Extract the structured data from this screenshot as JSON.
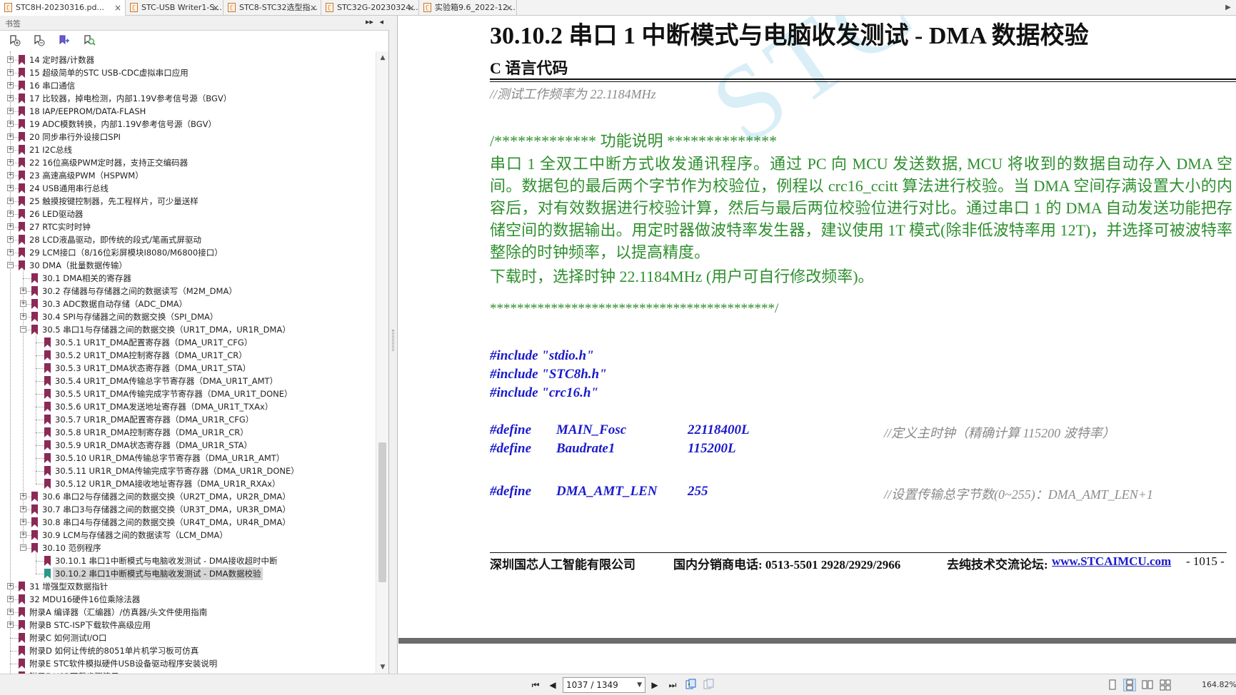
{
  "tabs": [
    {
      "label": "STC8H-20230316.pd...",
      "active": true
    },
    {
      "label": "STC-USB Writer1-S..."
    },
    {
      "label": "STC8-STC32选型指..."
    },
    {
      "label": "STC32G-20230324..."
    },
    {
      "label": "实验箱9.6_2022-12-..."
    }
  ],
  "panel": {
    "title": "书签",
    "expand_glyph": "▸▸",
    "collapse_glyph": "◂"
  },
  "bookmarks": [
    {
      "label": "14 定时器/计数器",
      "level": 0,
      "expander": "+"
    },
    {
      "label": "15 超级简单的STC USB-CDC虚拟串口应用",
      "level": 0,
      "expander": "+"
    },
    {
      "label": "16 串口通信",
      "level": 0,
      "expander": "+"
    },
    {
      "label": "17 比较器，掉电检测，内部1.19V参考信号源（BGV）",
      "level": 0,
      "expander": "+"
    },
    {
      "label": "18 IAP/EEPROM/DATA-FLASH",
      "level": 0,
      "expander": "+"
    },
    {
      "label": "19 ADC模数转换，内部1.19V参考信号源（BGV）",
      "level": 0,
      "expander": "+"
    },
    {
      "label": "20 同步串行外设接口SPI",
      "level": 0,
      "expander": "+"
    },
    {
      "label": "21 I2C总线",
      "level": 0,
      "expander": "+"
    },
    {
      "label": "22 16位高级PWM定时器，支持正交编码器",
      "level": 0,
      "expander": "+"
    },
    {
      "label": "23 高速高级PWM（HSPWM）",
      "level": 0,
      "expander": "+"
    },
    {
      "label": "24 USB通用串行总线",
      "level": 0,
      "expander": "+"
    },
    {
      "label": "25 触摸按键控制器，先工程样片，可少量送样",
      "level": 0,
      "expander": "+"
    },
    {
      "label": "26 LED驱动器",
      "level": 0,
      "expander": "+"
    },
    {
      "label": "27 RTC实时时钟",
      "level": 0,
      "expander": "+"
    },
    {
      "label": "28 LCD液晶驱动，即传统的段式/笔画式屏驱动",
      "level": 0,
      "expander": "+"
    },
    {
      "label": "29 LCM接口（8/16位彩屏模块I8080/M6800接口）",
      "level": 0,
      "expander": "+"
    },
    {
      "label": "30 DMA（批量数据传输）",
      "level": 0,
      "expander": "−"
    },
    {
      "label": "30.1 DMA相关的寄存器",
      "level": 1,
      "expander": ""
    },
    {
      "label": "30.2 存储器与存储器之间的数据读写（M2M_DMA）",
      "level": 1,
      "expander": "+"
    },
    {
      "label": "30.3 ADC数据自动存储（ADC_DMA）",
      "level": 1,
      "expander": "+"
    },
    {
      "label": "30.4 SPI与存储器之间的数据交换（SPI_DMA）",
      "level": 1,
      "expander": "+"
    },
    {
      "label": "30.5 串口1与存储器之间的数据交换（UR1T_DMA，UR1R_DMA）",
      "level": 1,
      "expander": "−"
    },
    {
      "label": "30.5.1 UR1T_DMA配置寄存器（DMA_UR1T_CFG）",
      "level": 2,
      "expander": ""
    },
    {
      "label": "30.5.2 UR1T_DMA控制寄存器（DMA_UR1T_CR）",
      "level": 2,
      "expander": ""
    },
    {
      "label": "30.5.3 UR1T_DMA状态寄存器（DMA_UR1T_STA）",
      "level": 2,
      "expander": ""
    },
    {
      "label": "30.5.4 UR1T_DMA传输总字节寄存器（DMA_UR1T_AMT）",
      "level": 2,
      "expander": ""
    },
    {
      "label": "30.5.5 UR1T_DMA传输完成字节寄存器（DMA_UR1T_DONE）",
      "level": 2,
      "expander": ""
    },
    {
      "label": "30.5.6 UR1T_DMA发送地址寄存器（DMA_UR1T_TXAx）",
      "level": 2,
      "expander": ""
    },
    {
      "label": "30.5.7 UR1R_DMA配置寄存器（DMA_UR1R_CFG）",
      "level": 2,
      "expander": ""
    },
    {
      "label": "30.5.8 UR1R_DMA控制寄存器（DMA_UR1R_CR）",
      "level": 2,
      "expander": ""
    },
    {
      "label": "30.5.9 UR1R_DMA状态寄存器（DMA_UR1R_STA）",
      "level": 2,
      "expander": ""
    },
    {
      "label": "30.5.10 UR1R_DMA传输总字节寄存器（DMA_UR1R_AMT）",
      "level": 2,
      "expander": ""
    },
    {
      "label": "30.5.11 UR1R_DMA传输完成字节寄存器（DMA_UR1R_DONE）",
      "level": 2,
      "expander": ""
    },
    {
      "label": "30.5.12 UR1R_DMA接收地址寄存器（DMA_UR1R_RXAx）",
      "level": 2,
      "expander": ""
    },
    {
      "label": "30.6 串口2与存储器之间的数据交换（UR2T_DMA，UR2R_DMA）",
      "level": 1,
      "expander": "+"
    },
    {
      "label": "30.7 串口3与存储器之间的数据交换（UR3T_DMA，UR3R_DMA）",
      "level": 1,
      "expander": "+"
    },
    {
      "label": "30.8 串口4与存储器之间的数据交换（UR4T_DMA，UR4R_DMA）",
      "level": 1,
      "expander": "+"
    },
    {
      "label": "30.9 LCM与存储器之间的数据读写（LCM_DMA）",
      "level": 1,
      "expander": "+"
    },
    {
      "label": "30.10 范例程序",
      "level": 1,
      "expander": "−"
    },
    {
      "label": "30.10.1 串口1中断模式与电脑收发测试 - DMA接收超时中断",
      "level": 2,
      "expander": ""
    },
    {
      "label": "30.10.2 串口1中断模式与电脑收发测试 - DMA数据校验",
      "level": 2,
      "expander": "",
      "selected": true
    },
    {
      "label": "31 增强型双数据指针",
      "level": 0,
      "expander": "+"
    },
    {
      "label": "32 MDU16硬件16位乘除法器",
      "level": 0,
      "expander": "+"
    },
    {
      "label": "附录A 编译器（汇编器）/仿真器/头文件使用指南",
      "level": 0,
      "expander": "+"
    },
    {
      "label": "附录B STC-ISP下载软件高级应用",
      "level": 0,
      "expander": "+"
    },
    {
      "label": "附录C 如何测试I/O口",
      "level": 0,
      "expander": ""
    },
    {
      "label": "附录D 如何让传统的8051单片机学习板可仿真",
      "level": 0,
      "expander": ""
    },
    {
      "label": "附录E STC软件模拟硬件USB设备驱动程序安装说明",
      "level": 0,
      "expander": ""
    },
    {
      "label": "附录F USB下载步骤演示",
      "level": 0,
      "expander": ""
    }
  ],
  "document": {
    "watermark": "STC",
    "section_title": "30.10.2   串口 1 中断模式与电脑收发测试  - DMA 数据校验",
    "subsection_title": "C 语言代码",
    "freq_comment": "//测试工作频率为 22.1184MHz",
    "func_header": "/*************    功能说明      **************",
    "description": "串口 1 全双工中断方式收发通讯程序。通过 PC 向 MCU 发送数据, MCU 将收到的数据自动存入 DMA 空间。数据包的最后两个字节作为校验位，例程以 crc16_ccitt 算法进行校验。当 DMA 空间存满设置大小的内容后，对有效数据进行校验计算，然后与最后两位校验位进行对比。通过串口 1 的 DMA 自动发送功能把存储空间的数据输出。用定时器做波特率发生器，建议使用 1T 模式(除非低波特率用 12T)，并选择可被波特率整除的时钟频率，以提高精度。",
    "download_note": "下载时，选择时钟  22.1184MHz (用户可自行修改频率)。",
    "stars_end": "******************************************/",
    "includes": [
      "#include \"stdio.h\"",
      "#include \"STC8h.h\"",
      "#include \"crc16.h\""
    ],
    "defines": [
      {
        "kw": "#define",
        "name": "MAIN_Fosc",
        "value": "22118400L",
        "comment": "//定义主时钟（精确计算 115200 波特率）"
      },
      {
        "kw": "#define",
        "name": "Baudrate1",
        "value": "115200L",
        "comment": ""
      },
      {
        "kw": "#define",
        "name": "DMA_AMT_LEN",
        "value": "255",
        "comment": "//设置传输总字节数(0~255)：DMA_AMT_LEN+1"
      }
    ],
    "footer": {
      "company": "深圳国芯人工智能有限公司",
      "phone": "国内分销商电话: 0513-5501 2928/2929/2966",
      "forum_label": "去纯技术交流论坛:",
      "forum_link": "www.STCAIMCU.com",
      "page_label": "- 1015 -"
    }
  },
  "statusbar": {
    "page_indicator": "1037 / 1349",
    "zoom": "164.82%"
  }
}
